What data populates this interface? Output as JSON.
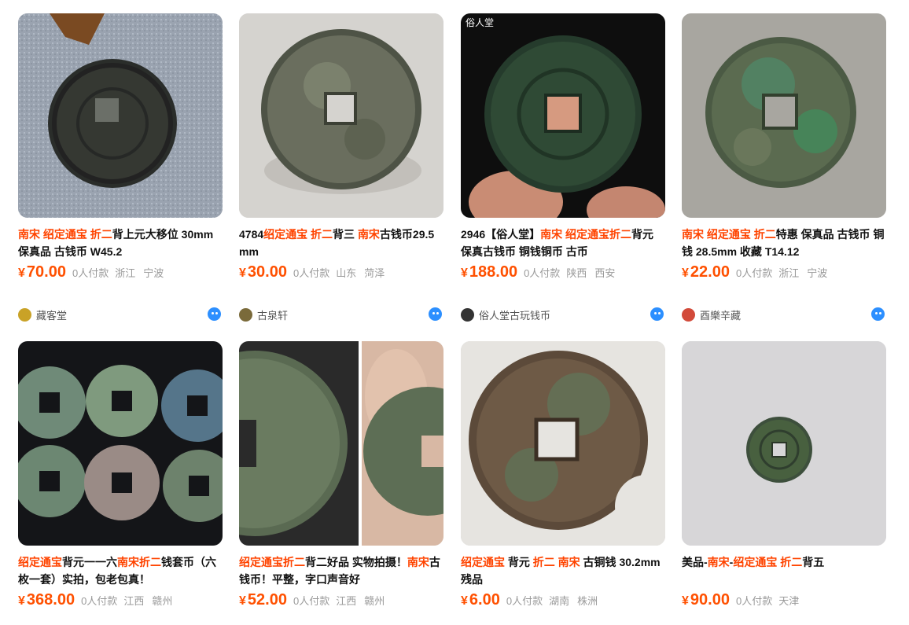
{
  "listings": [
    {
      "title_parts": [
        {
          "text": "南宋 绍定通宝 折二",
          "hl": true
        },
        {
          "text": "背上元大移位 30mm 保真品 古钱币 W45.2",
          "hl": false
        }
      ],
      "currency": "¥",
      "price": "70.00",
      "sold": "0人付款",
      "province": "浙江",
      "city": "宁波",
      "shop": "藏客堂",
      "avatar_color": "#c9a227"
    },
    {
      "title_parts": [
        {
          "text": "4784",
          "hl": false
        },
        {
          "text": "绍定通宝 折二",
          "hl": true
        },
        {
          "text": "背三 ",
          "hl": false
        },
        {
          "text": "南宋",
          "hl": true
        },
        {
          "text": "古钱币29.5mm",
          "hl": false
        }
      ],
      "currency": "¥",
      "price": "30.00",
      "sold": "0人付款",
      "province": "山东",
      "city": "菏泽",
      "shop": "古泉轩",
      "avatar_color": "#7a6a3a"
    },
    {
      "title_parts": [
        {
          "text": "2946【俗人堂】",
          "hl": false
        },
        {
          "text": "南宋 绍定通宝折二",
          "hl": true
        },
        {
          "text": "背元 保真古钱币 铜钱铜币 古币",
          "hl": false
        }
      ],
      "currency": "¥",
      "price": "188.00",
      "sold": "0人付款",
      "province": "陕西",
      "city": "西安",
      "shop": "俗人堂古玩钱币",
      "avatar_color": "#333333"
    },
    {
      "title_parts": [
        {
          "text": "南宋 绍定通宝 折二",
          "hl": true
        },
        {
          "text": "特惠 保真品 古钱币 铜钱 28.5mm 收藏 T14.12",
          "hl": false
        }
      ],
      "currency": "¥",
      "price": "22.00",
      "sold": "0人付款",
      "province": "浙江",
      "city": "宁波",
      "shop": "酉樂辛藏",
      "avatar_color": "#d24a3a"
    },
    {
      "title_parts": [
        {
          "text": "绍定通宝",
          "hl": true
        },
        {
          "text": "背元一一六",
          "hl": false
        },
        {
          "text": "南宋折二",
          "hl": true
        },
        {
          "text": "钱套币（六枚一套）实拍，包老包真！",
          "hl": false
        }
      ],
      "currency": "¥",
      "price": "368.00",
      "sold": "0人付款",
      "province": "江西",
      "city": "赣州"
    },
    {
      "title_parts": [
        {
          "text": "绍定通宝折二",
          "hl": true
        },
        {
          "text": "背二好品 实物拍摄！",
          "hl": false
        },
        {
          "text": "南宋",
          "hl": true
        },
        {
          "text": "古钱币！平整，字口声音好",
          "hl": false
        }
      ],
      "currency": "¥",
      "price": "52.00",
      "sold": "0人付款",
      "province": "江西",
      "city": "赣州"
    },
    {
      "title_parts": [
        {
          "text": "绍定通宝",
          "hl": true
        },
        {
          "text": " 背元 ",
          "hl": false
        },
        {
          "text": "折二 南宋",
          "hl": true
        },
        {
          "text": " 古铜钱 30.2mm 残品",
          "hl": false
        }
      ],
      "currency": "¥",
      "price": "6.00",
      "sold": "0人付款",
      "province": "湖南",
      "city": "株洲"
    },
    {
      "title_parts": [
        {
          "text": "美品-",
          "hl": false
        },
        {
          "text": "南宋",
          "hl": true
        },
        {
          "text": "-",
          "hl": false
        },
        {
          "text": "绍定通宝 折二",
          "hl": true
        },
        {
          "text": "背五",
          "hl": false
        }
      ],
      "currency": "¥",
      "price": "90.00",
      "sold": "0人付款",
      "province": "天津",
      "city": ""
    }
  ],
  "images": [
    {
      "watermark": ""
    },
    {
      "watermark": ""
    },
    {
      "watermark": "俗人堂"
    },
    {
      "watermark": ""
    },
    {
      "watermark": ""
    },
    {
      "watermark": ""
    },
    {
      "watermark": ""
    },
    {
      "watermark": ""
    }
  ],
  "colors": {
    "price": "#ff5000",
    "highlight": "#ff4400",
    "muted": "#9a9a9a",
    "chat_icon": "#2c8fff"
  }
}
